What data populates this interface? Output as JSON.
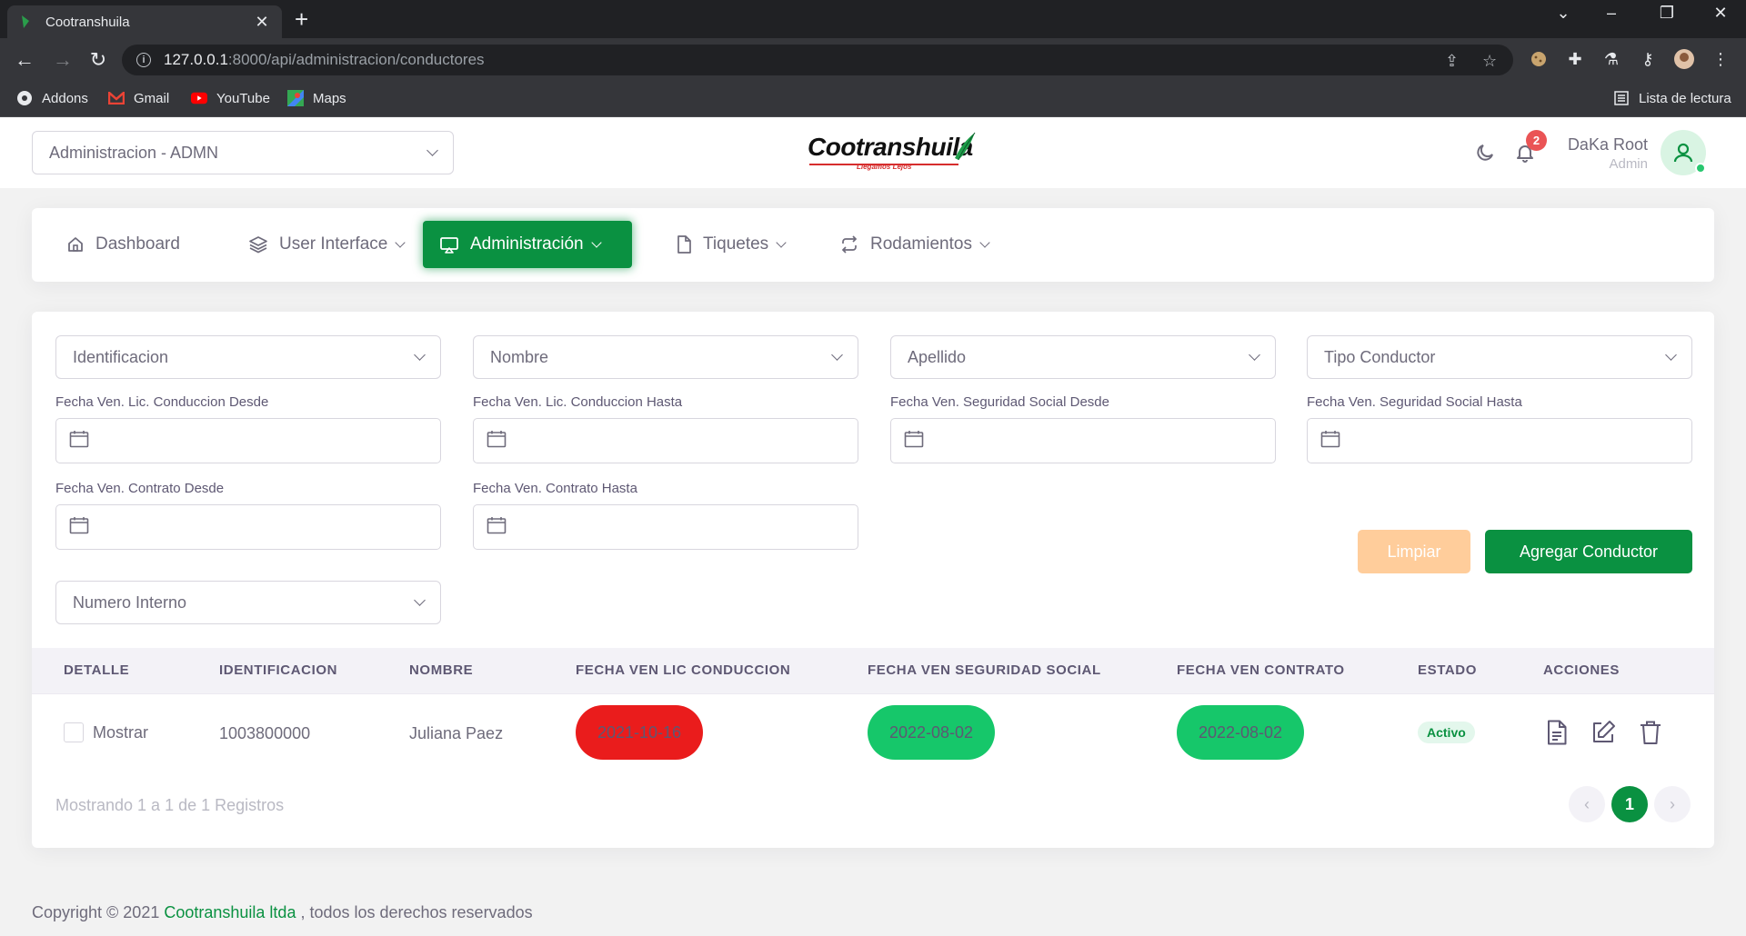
{
  "browser": {
    "tab_title": "Cootranshuila",
    "url_host": "127.0.0.1",
    "url_path": ":8000/api/administracion/conductores",
    "bookmarks": [
      "Addons",
      "Gmail",
      "YouTube",
      "Maps"
    ],
    "reading_list": "Lista de lectura"
  },
  "header": {
    "module_select": "Administracion - ADMN",
    "logo_text": "Cootranshuila",
    "logo_tagline": "Llegamos Lejos",
    "notification_count": "2",
    "user_name": "DaKa Root",
    "user_role": "Admin"
  },
  "nav": {
    "items": [
      {
        "label": "Dashboard",
        "icon": "home-icon"
      },
      {
        "label": "User Interface",
        "icon": "layers-icon"
      },
      {
        "label": "Administración",
        "icon": "cast-icon",
        "active": true
      },
      {
        "label": "Tiquetes",
        "icon": "file-icon"
      },
      {
        "label": "Rodamientos",
        "icon": "repeat-icon"
      }
    ]
  },
  "filters": {
    "identificacion": "Identificacion",
    "nombre": "Nombre",
    "apellido": "Apellido",
    "tipo_conductor": "Tipo Conductor",
    "numero_interno": "Numero Interno",
    "dates": [
      "Fecha Ven. Lic. Conduccion Desde",
      "Fecha Ven. Lic. Conduccion Hasta",
      "Fecha Ven. Seguridad Social Desde",
      "Fecha Ven. Seguridad Social Hasta",
      "Fecha Ven. Contrato Desde",
      "Fecha Ven. Contrato Hasta"
    ],
    "clear_label": "Limpiar",
    "add_label": "Agregar Conductor"
  },
  "table": {
    "columns": [
      "DETALLE",
      "IDENTIFICACION",
      "NOMBRE",
      "FECHA VEN LIC CONDUCCION",
      "FECHA VEN SEGURIDAD SOCIAL",
      "FECHA VEN CONTRATO",
      "ESTADO",
      "ACCIONES"
    ],
    "rows": [
      {
        "detalle": "Mostrar",
        "identificacion": "1003800000",
        "nombre": "Juliana Paez",
        "lic_conduccion": "2021-10-16",
        "seguridad_social": "2022-08-02",
        "contrato": "2022-08-02",
        "estado": "Activo"
      }
    ],
    "summary": "Mostrando 1 a 1 de 1 Registros",
    "current_page": "1",
    "prev": "‹",
    "next": "›"
  },
  "footer": {
    "prefix": "Copyright © 2021 ",
    "company": "Cootranshuila ltda",
    "suffix": " , todos los derechos reservados"
  },
  "colors": {
    "primary": "#0a9141",
    "danger_pill": "#ea1c1c",
    "success_pill": "#16c76a",
    "clear_button": "#ffcd9b"
  }
}
